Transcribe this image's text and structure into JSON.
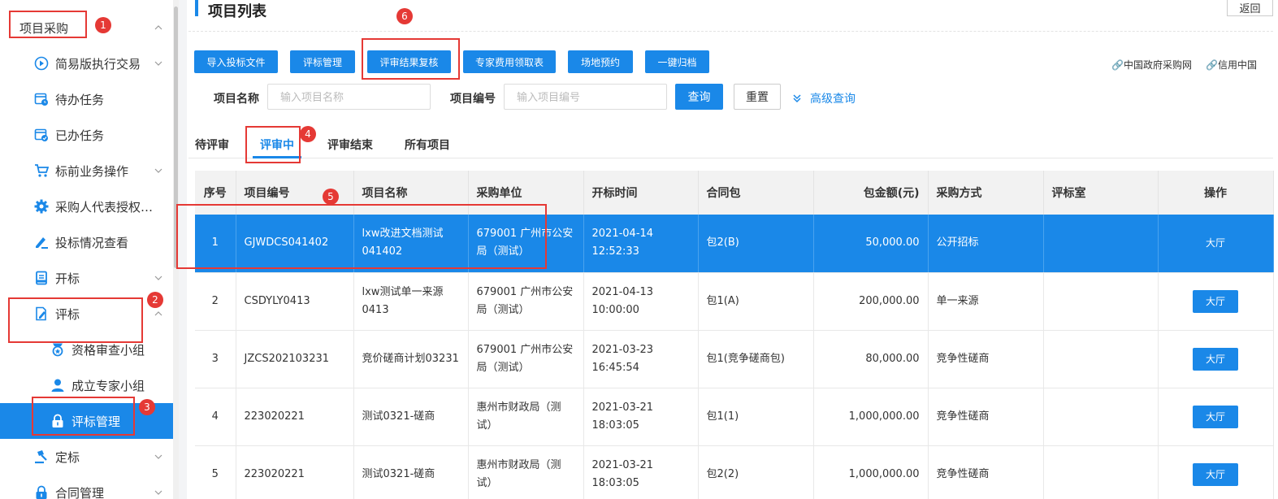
{
  "sidebar": {
    "items": [
      {
        "label": "项目采购",
        "icon": "none",
        "chevron": "up"
      },
      {
        "label": "简易版执行交易",
        "icon": "play-circle-icon",
        "chevron": "down"
      },
      {
        "label": "待办任务",
        "icon": "task-calendar-icon",
        "chevron": ""
      },
      {
        "label": "已办任务",
        "icon": "done-calendar-icon",
        "chevron": ""
      },
      {
        "label": "标前业务操作",
        "icon": "cart-icon",
        "chevron": "down"
      },
      {
        "label": "采购人代表授权…",
        "icon": "gear-icon",
        "chevron": ""
      },
      {
        "label": "投标情况查看",
        "icon": "pen-icon",
        "chevron": ""
      },
      {
        "label": "开标",
        "icon": "document-icon",
        "chevron": "down"
      },
      {
        "label": "评标",
        "icon": "edit-doc-icon",
        "chevron": "up"
      },
      {
        "label": "资格审查小组",
        "icon": "badge-icon",
        "chevron": ""
      },
      {
        "label": "成立专家小组",
        "icon": "user-icon",
        "chevron": ""
      },
      {
        "label": "评标管理",
        "icon": "lock-icon",
        "chevron": ""
      },
      {
        "label": "定标",
        "icon": "gavel-icon",
        "chevron": "down"
      },
      {
        "label": "合同管理",
        "icon": "lock-icon",
        "chevron": "down"
      }
    ]
  },
  "header": {
    "title": "项目列表",
    "back_label": "返回"
  },
  "toolbar": {
    "buttons": [
      "导入投标文件",
      "评标管理",
      "评审结果复核",
      "专家费用领取表",
      "场地预约",
      "一键归档"
    ],
    "links": [
      "中国政府采购网",
      "信用中国"
    ]
  },
  "search": {
    "name_label": "项目名称",
    "name_placeholder": "输入项目名称",
    "code_label": "项目编号",
    "code_placeholder": "输入项目编号",
    "query_label": "查询",
    "reset_label": "重置",
    "advanced_label": "高级查询"
  },
  "tabs": [
    "待评审",
    "评审中",
    "评审结束",
    "所有项目"
  ],
  "table": {
    "headers": [
      "序号",
      "项目编号",
      "项目名称",
      "采购单位",
      "开标时间",
      "合同包",
      "包金额(元)",
      "采购方式",
      "评标室",
      "操作"
    ],
    "rows": [
      [
        "1",
        "GJWDCS041402",
        "lxw改进文档测试041402",
        "679001 广州市公安局（测试）",
        "2021-04-14 12:52:33",
        "包2(B)",
        "50,000.00",
        "公开招标",
        "",
        "大厅"
      ],
      [
        "2",
        "CSDYLY0413",
        "lxw测试单一来源0413",
        "679001 广州市公安局（测试）",
        "2021-04-13 10:00:00",
        "包1(A)",
        "200,000.00",
        "单一来源",
        "",
        "大厅"
      ],
      [
        "3",
        "JZCS202103231",
        "竞价磋商计划03231",
        "679001 广州市公安局（测试）",
        "2021-03-23 16:45:54",
        "包1(竞争磋商包)",
        "80,000.00",
        "竞争性磋商",
        "",
        "大厅"
      ],
      [
        "4",
        "223020221",
        "测试0321-磋商",
        "惠州市财政局（测试）",
        "2021-03-21 18:03:05",
        "包1(1)",
        "1,000,000.00",
        "竞争性磋商",
        "",
        "大厅"
      ],
      [
        "5",
        "223020221",
        "测试0321-磋商",
        "惠州市财政局（测试）",
        "2021-03-21 18:03:05",
        "包2(2)",
        "1,000,000.00",
        "竞争性磋商",
        "",
        "大厅"
      ]
    ]
  },
  "annotations": [
    "1",
    "2",
    "3",
    "4",
    "5",
    "6"
  ],
  "colors": {
    "accent": "#1a88e8",
    "annotation": "#e53935"
  }
}
